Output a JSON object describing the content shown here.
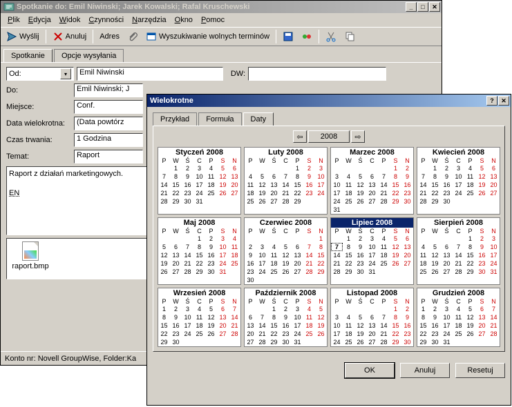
{
  "mainWindow": {
    "title": "Spotkanie do: Emil Niwinski; Jarek Kowalski; Rafal Kruschewski",
    "menu": {
      "plik": "Plik",
      "edycja": "Edycja",
      "widok": "Widok",
      "czynnosci": "Czynności",
      "narzedzia": "Narzędzia",
      "okno": "Okno",
      "pomoc": "Pomoc"
    },
    "toolbar": {
      "wyslij": "Wyślij",
      "anuluj": "Anuluj",
      "adres": "Adres",
      "wyszuk": "Wyszukiwanie wolnych terminów"
    },
    "tabs": {
      "spotkanie": "Spotkanie",
      "opcje": "Opcje wysyłania"
    },
    "form": {
      "odLabel": "Od:",
      "odValue": "Emil Niwinski",
      "dwLabel": "DW:",
      "dwValue": "",
      "doLabel": "Do:",
      "doValue": "Emil Niwinski; J",
      "miejsceLabel": "Miejsce:",
      "miejsceValue": "Conf.",
      "dataLabel": "Data wielokrotna:",
      "dataValue": "(Data powtórz",
      "czasLabel": "Czas trwania:",
      "czasValue": "1 Godzina",
      "tematLabel": "Temat:",
      "tematValue": "Raport",
      "bodyLine1": "Raport z działań marketingowych.",
      "bodyLine2": "EN",
      "attachment": "raport.bmp"
    },
    "status": "Konto nr: Novell GroupWise,  Folder:Ka"
  },
  "dialog": {
    "title": "Wielokrotne",
    "tabs": {
      "przyklad": "Przykład",
      "formula": "Formuła",
      "daty": "Daty"
    },
    "year": "2008",
    "dow": [
      "P",
      "W",
      "Ś",
      "C",
      "P",
      "S",
      "N"
    ],
    "months": [
      {
        "name": "Styczeń 2008",
        "start": 1,
        "days": 31,
        "active": false,
        "today": null
      },
      {
        "name": "Luty 2008",
        "start": 4,
        "days": 29,
        "active": false,
        "today": null
      },
      {
        "name": "Marzec 2008",
        "start": 5,
        "days": 31,
        "active": false,
        "today": null
      },
      {
        "name": "Kwiecień 2008",
        "start": 1,
        "days": 30,
        "active": false,
        "today": null
      },
      {
        "name": "Maj 2008",
        "start": 3,
        "days": 31,
        "active": false,
        "today": null
      },
      {
        "name": "Czerwiec 2008",
        "start": 6,
        "days": 30,
        "active": false,
        "today": null
      },
      {
        "name": "Lipiec 2008",
        "start": 1,
        "days": 31,
        "active": true,
        "today": 7
      },
      {
        "name": "Sierpień 2008",
        "start": 4,
        "days": 31,
        "active": false,
        "today": null
      },
      {
        "name": "Wrzesień 2008",
        "start": 0,
        "days": 30,
        "active": false,
        "today": null
      },
      {
        "name": "Październik 2008",
        "start": 2,
        "days": 31,
        "active": false,
        "today": null
      },
      {
        "name": "Listopad 2008",
        "start": 5,
        "days": 30,
        "active": false,
        "today": null
      },
      {
        "name": "Grudzień 2008",
        "start": 0,
        "days": 31,
        "active": false,
        "today": null
      }
    ],
    "buttons": {
      "ok": "OK",
      "anuluj": "Anuluj",
      "resetuj": "Resetuj"
    }
  }
}
